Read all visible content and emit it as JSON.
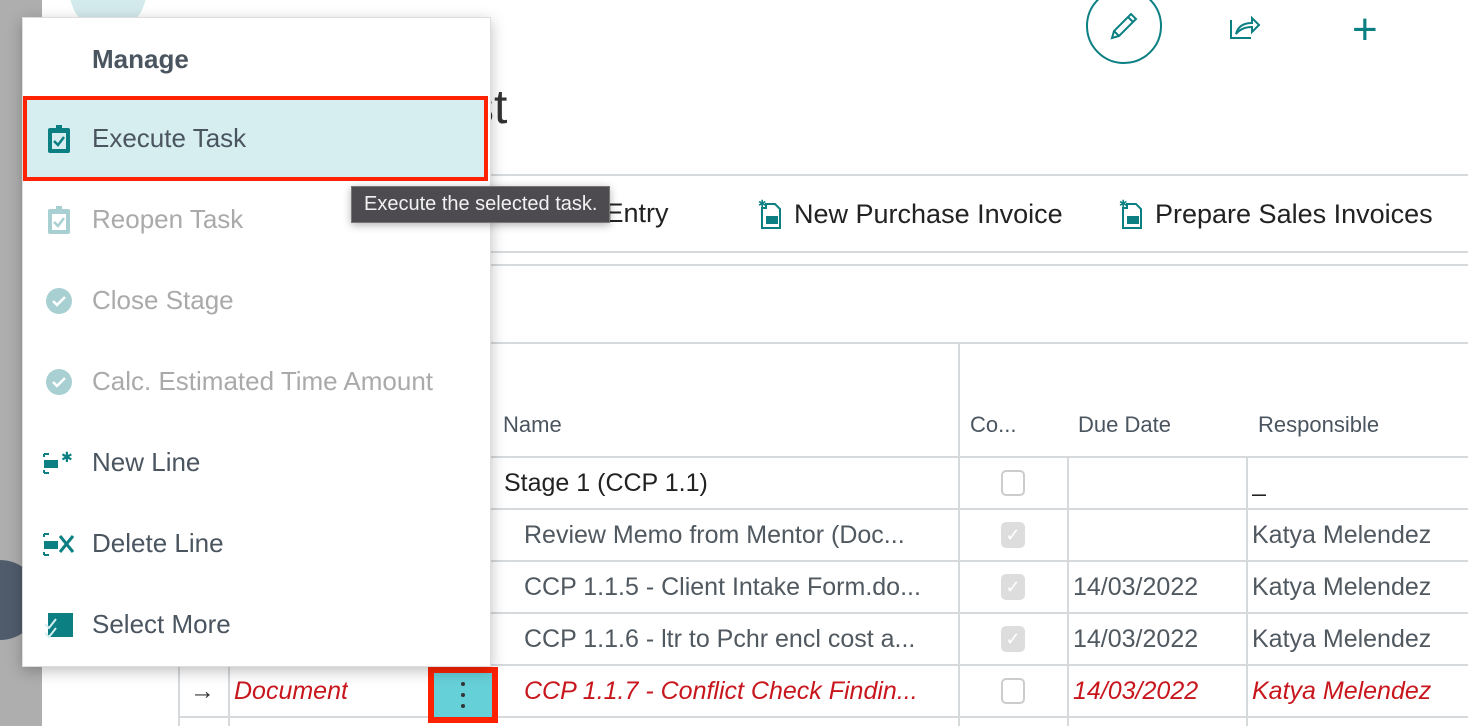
{
  "page": {
    "title_visible": "st"
  },
  "header_actions": [
    {
      "icon": "pencil-icon"
    },
    {
      "icon": "share-icon"
    },
    {
      "icon": "plus-icon"
    }
  ],
  "action_bar": {
    "items": [
      {
        "label": "New Time Entry"
      },
      {
        "label": "New Purchase Invoice"
      },
      {
        "label": "Prepare Sales Invoices"
      }
    ]
  },
  "table": {
    "columns": [
      "Name",
      "Co...",
      "Due Date",
      "Responsible"
    ],
    "rows": [
      {
        "name": "Stage 1 (CCP 1.1)",
        "completed": false,
        "due_date": "",
        "responsible": "_",
        "style": "stage"
      },
      {
        "name": "Review Memo from Mentor (Doc...",
        "completed": true,
        "due_date": "",
        "responsible": "Katya Melendez",
        "style": "done"
      },
      {
        "name": "CCP 1.1.5 - Client Intake Form.do...",
        "completed": true,
        "due_date": "14/03/2022",
        "responsible": "Katya Melendez",
        "style": "done"
      },
      {
        "name": "CCP 1.1.6 - ltr to Pchr encl cost a...",
        "completed": true,
        "due_date": "14/03/2022",
        "responsible": "Katya Melendez",
        "style": "done"
      },
      {
        "type": "Document",
        "name": "CCP 1.1.7 - Conflict Check Findin...",
        "completed": false,
        "due_date": "14/03/2022",
        "responsible": "Katya Melendez",
        "style": "overdue",
        "selected": true
      }
    ]
  },
  "menu": {
    "heading": "Manage",
    "items": [
      {
        "label": "Execute Task",
        "icon": "clipboard-check-icon",
        "enabled": true,
        "highlighted": true
      },
      {
        "label": "Reopen Task",
        "icon": "clipboard-check-icon",
        "enabled": false
      },
      {
        "label": "Close Stage",
        "icon": "check-circle-icon",
        "enabled": false
      },
      {
        "label": "Calc. Estimated Time Amount",
        "icon": "check-circle-icon",
        "enabled": false
      },
      {
        "label": "New Line",
        "icon": "new-line-icon",
        "enabled": true
      },
      {
        "label": "Delete Line",
        "icon": "delete-line-icon",
        "enabled": true
      },
      {
        "label": "Select More",
        "icon": "select-more-icon",
        "enabled": true
      }
    ]
  },
  "tooltip": "Execute the selected task.",
  "colors": {
    "accent": "#0b7f82",
    "highlight": "#d6eef0",
    "annotation": "#ff2200",
    "overdue": "#c8161d",
    "row_menu_button": "#66d0d8"
  }
}
